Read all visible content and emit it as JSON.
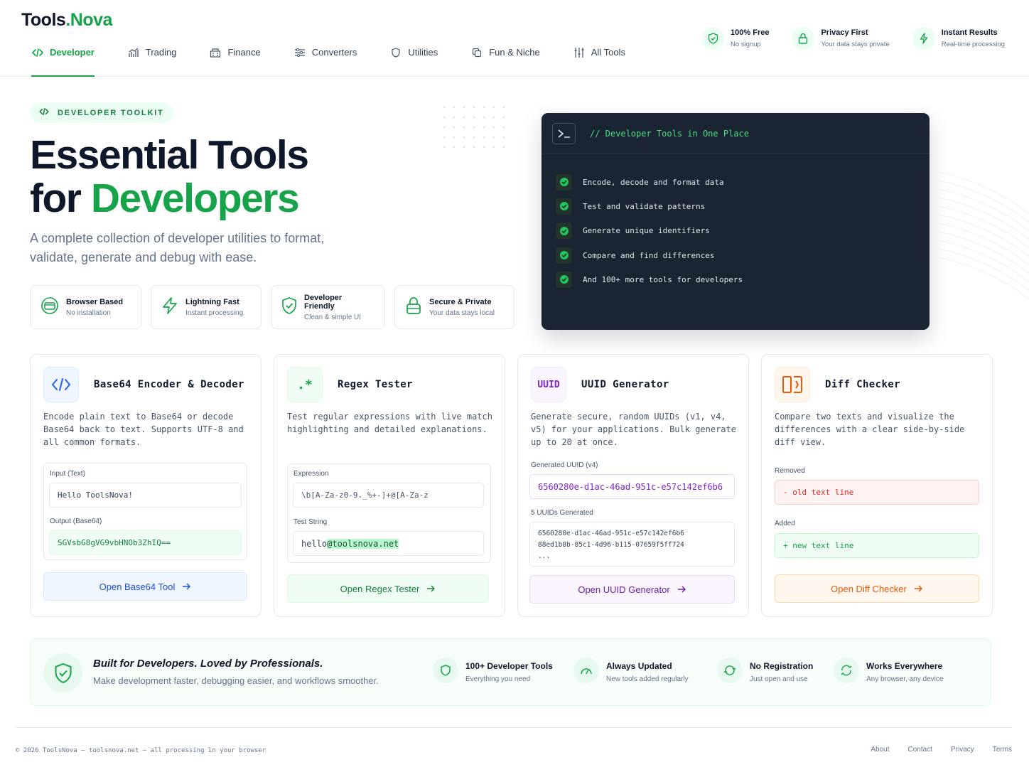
{
  "brand": {
    "name_main": "Tools",
    "name_dot": ".",
    "name_accent": "Nova"
  },
  "nav": [
    {
      "label": "Developer",
      "icon": "code-icon",
      "active": true
    },
    {
      "label": "Trading",
      "icon": "chart-icon"
    },
    {
      "label": "Finance",
      "icon": "bank-icon"
    },
    {
      "label": "Converters",
      "icon": "sliders-icon"
    },
    {
      "label": "Utilities",
      "icon": "shield-icon"
    },
    {
      "label": "Fun & Niche",
      "icon": "copy-icon"
    },
    {
      "label": "All Tools",
      "icon": "tools-icon"
    }
  ],
  "perks": [
    {
      "title": "100% Free",
      "sub": "No signup",
      "icon": "shield-check-icon"
    },
    {
      "title": "Privacy First",
      "sub": "Your data stays private",
      "icon": "lock-icon"
    },
    {
      "title": "Instant Results",
      "sub": "Real-time processing",
      "icon": "bolt-icon"
    }
  ],
  "hero": {
    "badge": "DEVELOPER TOOLKIT",
    "title_line1": "Essential Tools",
    "title_line2_plain": "for ",
    "title_line2_accent": "Developers",
    "subtitle": "A complete collection of developer utilities to format, validate, generate and debug with ease."
  },
  "features": [
    {
      "title": "Browser Based",
      "sub": "No installation",
      "icon": "browser-icon"
    },
    {
      "title": "Lightning Fast",
      "sub": "Instant processing",
      "icon": "bolt-icon"
    },
    {
      "title": "Developer Friendly",
      "sub": "Clean & simple UI",
      "icon": "shield-check-icon"
    },
    {
      "title": "Secure & Private",
      "sub": "Your data stays local",
      "icon": "lock-icon"
    }
  ],
  "terminal": {
    "title": "// Developer Tools in One Place",
    "items": [
      "Encode, decode and format data",
      "Test and validate patterns",
      "Generate unique identifiers",
      "Compare and find differences",
      "And 100+ more tools for developers"
    ]
  },
  "cards": {
    "base64": {
      "title": "Base64 Encoder & Decoder",
      "icon": "code-icon",
      "desc": "Encode plain text to Base64 or decode Base64 back to text. Supports UTF-8 and all common formats.",
      "input_label": "Input (Text)",
      "input_value": "Hello ToolsNova!",
      "output_label": "Output (Base64)",
      "output_value": "SGVsbG8gVG9vbHNOb3ZhIQ==",
      "button": "Open Base64 Tool"
    },
    "regex": {
      "title": "Regex Tester",
      "icon": "regex-icon",
      "icon_text": ".*",
      "desc": "Test regular expressions with live match highlighting and detailed explanations.",
      "expr_label": "Expression",
      "expr_value": "\\b[A-Za-z0-9._%+-]+@[A-Za-z",
      "test_label": "Test String",
      "test_plain": "hello",
      "test_match": "@toolsnova.net",
      "button": "Open Regex Tester"
    },
    "uuid": {
      "title": "UUID Generator",
      "icon": "uuid-icon",
      "icon_text": "UUID",
      "desc": "Generate secure, random UUIDs (v1, v4, v5) for your applications. Bulk generate up to 20 at once.",
      "gen_label": "Generated UUID (v4)",
      "gen_value": "6560280e-d1ac-46ad-951c-e57c142ef6b6",
      "list_label": "5 UUIDs Generated",
      "list": [
        "6560280e-d1ac-46ad-951c-e57c142ef6b6",
        "88ed1b8b-85c1-4d96-b115-07659f5ff724",
        "..."
      ],
      "button": "Open UUID Generator"
    },
    "diff": {
      "title": "Diff Checker",
      "icon": "diff-icon",
      "desc": "Compare two texts and visualize the differences with a clear side-by-side diff view.",
      "removed_label": "Removed",
      "removed_value": "- old text line",
      "added_label": "Added",
      "added_value": "+ new text line",
      "button": "Open Diff Checker"
    }
  },
  "banner": {
    "title": "Built for Developers. Loved by Professionals.",
    "sub": "Make development faster, debugging easier, and workflows smoother.",
    "stats": [
      {
        "title": "100+ Developer Tools",
        "sub": "Everything you need",
        "icon": "shield-icon"
      },
      {
        "title": "Always Updated",
        "sub": "New tools added regularly",
        "icon": "gauge-icon"
      },
      {
        "title": "No Registration",
        "sub": "Just open and use",
        "icon": "refresh-icon"
      },
      {
        "title": "Works Everywhere",
        "sub": "Any browser, any device",
        "icon": "sync-icon"
      }
    ]
  },
  "footer": {
    "copy": "© 2026 ToolsNova — toolsnova.net — all processing in your browser",
    "links": [
      "About",
      "Contact",
      "Privacy",
      "Terms"
    ]
  },
  "colors": {
    "accent": "#16a34a",
    "dark": "#0f172a",
    "terminal_bg": "#1a2433"
  }
}
